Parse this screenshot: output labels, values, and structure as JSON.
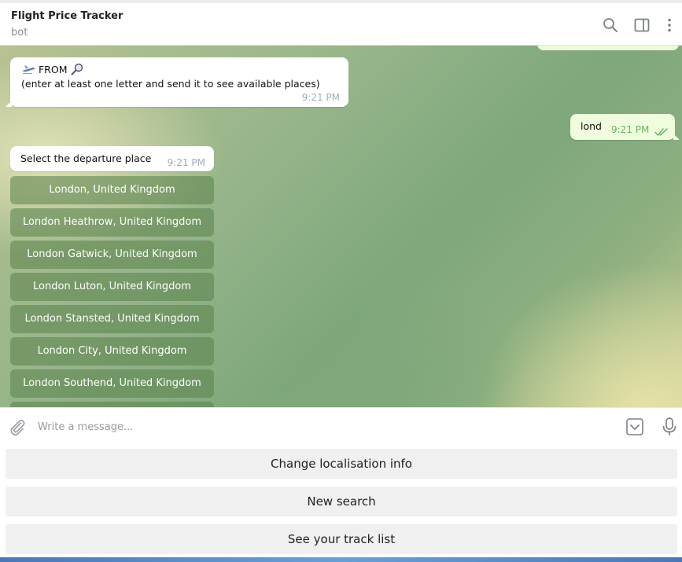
{
  "header": {
    "title": "Flight Price Tracker",
    "subtitle": "bot",
    "icons": [
      "search-icon",
      "sidebar-toggle-icon",
      "more-vertical-icon"
    ]
  },
  "messages": {
    "prompt": {
      "line1": "FROM",
      "line1_icons": [
        "airplane-icon",
        "magnifier-icon"
      ],
      "line2": "(enter at least one letter and send it to see available places)",
      "time": "9:21 PM"
    },
    "user_reply": {
      "text": "lond",
      "time": "9:21 PM",
      "status": "read-double-check"
    },
    "select": {
      "text": "Select the departure place",
      "time": "9:21 PM"
    }
  },
  "place_options": [
    "London, United Kingdom",
    "London Heathrow, United Kingdom",
    "London Gatwick, United Kingdom",
    "London Luton, United Kingdom",
    "London Stansted, United Kingdom",
    "London City, United Kingdom",
    "London Southend, United Kingdom"
  ],
  "composer": {
    "placeholder": "Write a message...",
    "value": ""
  },
  "reply_keyboard": {
    "buttons": [
      "Change localisation info",
      "New search",
      "See your track list"
    ]
  },
  "colors": {
    "outgoing_bubble": "#effdde",
    "incoming_bubble": "#ffffff",
    "inline_button": "#5a824b",
    "read_check": "#6cb35f"
  }
}
